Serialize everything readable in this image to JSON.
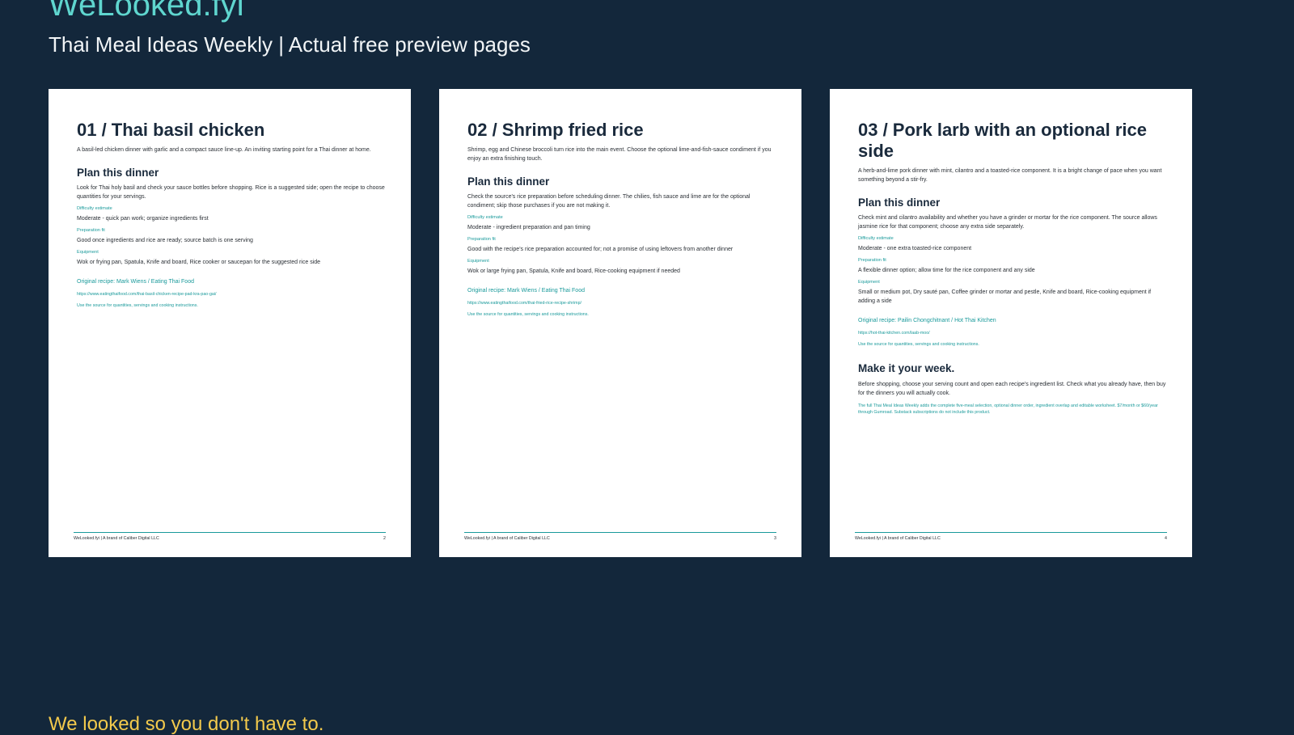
{
  "header": {
    "brand": "WeLooked.fyi",
    "subtitle": "Thai Meal Ideas Weekly | Actual free preview pages"
  },
  "tagline": "We looked so you don't have to.",
  "labels": {
    "plan_heading": "Plan this dinner",
    "difficulty": "Difficulty estimate",
    "prep": "Preparation fit",
    "equipment": "Equipment",
    "use_source": "Use the source for quantities, servings and cooking instructions.",
    "footer_left": "WeLooked.fyi | A brand of Caliber Digital LLC"
  },
  "pages": [
    {
      "title": "01 / Thai basil chicken",
      "intro": "A basil-led chicken dinner with garlic and a compact sauce line-up. An inviting starting point for a Thai dinner at home.",
      "plan": "Look for Thai holy basil and check your sauce bottles before shopping. Rice is a suggested side; open the recipe to choose quantities for your servings.",
      "difficulty": "Moderate - quick pan work; organize ingredients first",
      "prep": "Good once ingredients and rice are ready; source batch is one serving",
      "equipment": "Wok or frying pan, Spatula, Knife and board, Rice cooker or saucepan for the suggested rice side",
      "source": "Original recipe: Mark Wiens / Eating Thai Food",
      "url": "https://www.eatingthaifood.com/thai-basil-chicken-recipe-pad-kra-pao-gai/",
      "page_number": "2"
    },
    {
      "title": "02 / Shrimp fried rice",
      "intro": "Shrimp, egg and Chinese broccoli turn rice into the main event. Choose the optional lime-and-fish-sauce condiment if you enjoy an extra finishing touch.",
      "plan": "Check the source's rice preparation before scheduling dinner. The chilies, fish sauce and lime are for the optional condiment; skip those purchases if you are not making it.",
      "difficulty": "Moderate - ingredient preparation and pan timing",
      "prep": "Good with the recipe's rice preparation accounted for; not a promise of using leftovers from another dinner",
      "equipment": "Wok or large frying pan, Spatula, Knife and board, Rice-cooking equipment if needed",
      "source": "Original recipe: Mark Wiens / Eating Thai Food",
      "url": "https://www.eatingthaifood.com/thai-fried-rice-recipe-shrimp/",
      "page_number": "3"
    },
    {
      "title": "03 / Pork larb with an optional rice side",
      "intro": "A herb-and-lime pork dinner with mint, cilantro and a toasted-rice component. It is a bright change of pace when you want something beyond a stir-fry.",
      "plan": "Check mint and cilantro availability and whether you have a grinder or mortar for the rice component. The source allows jasmine rice for that component; choose any extra side separately.",
      "difficulty": "Moderate - one extra toasted-rice component",
      "prep": "A flexible dinner option; allow time for the rice component and any side",
      "equipment": "Small or medium pot, Dry sauté pan, Coffee grinder or mortar and pestle, Knife and board, Rice-cooking equipment if adding a side",
      "source": "Original recipe: Pailin Chongchitnant / Hot Thai Kitchen",
      "url": "https://hot-thai-kitchen.com/laab-moo/",
      "page_number": "4",
      "week_heading": "Make it your week.",
      "week_text": "Before shopping, choose your serving count and open each recipe's ingredient list. Check what you already have, then buy for the dinners you will actually cook.",
      "promo": "The full Thai Meal Ideas Weekly adds the complete five-meal selection, optional dinner order, ingredient overlap and editable worksheet. $7/month or $60/year through Gumroad. Substack subscriptions do not include this product."
    }
  ]
}
